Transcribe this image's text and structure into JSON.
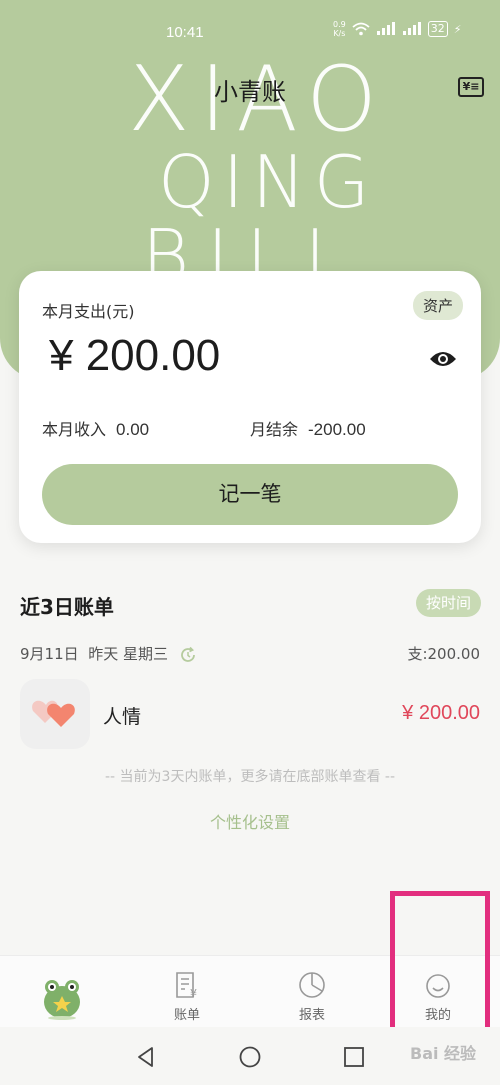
{
  "status_bar": {
    "time": "10:41",
    "net_speed_value": "0.9",
    "net_speed_unit": "K/s",
    "battery": "32"
  },
  "header": {
    "title": "小青账",
    "watermark_lines": [
      "XIAO",
      "QING",
      "BILL"
    ]
  },
  "summary": {
    "month_expense_label": "本月支出(元)",
    "assets_label": "资产",
    "month_expense_amount": "¥ 200.00",
    "month_income_label": "本月收入",
    "month_income_value": "0.00",
    "month_balance_label": "月结余",
    "month_balance_value": "-200.00",
    "record_button": "记一笔"
  },
  "recent": {
    "title": "近3日账单",
    "sort_label": "按时间",
    "date": "9月11日",
    "relative_day": "昨天",
    "weekday": "星期三",
    "day_total": "支:200.00",
    "bills": [
      {
        "category": "人情",
        "amount": "¥ 200.00",
        "icon": "heart-icon"
      }
    ],
    "notice": "-- 当前为3天内账单，更多请在底部账单查看 --",
    "settings_link": "个性化设置"
  },
  "bottom_nav": {
    "items": [
      {
        "label": "",
        "icon": "frog-mascot-icon"
      },
      {
        "label": "账单",
        "icon": "bill-icon"
      },
      {
        "label": "报表",
        "icon": "report-pie-icon"
      },
      {
        "label": "我的",
        "icon": "smile-icon"
      }
    ]
  },
  "watermark": "Bai 经验",
  "colors": {
    "accent": "#b5cb9d",
    "expense_red": "#e0475a",
    "highlight": "#e22e7e"
  }
}
